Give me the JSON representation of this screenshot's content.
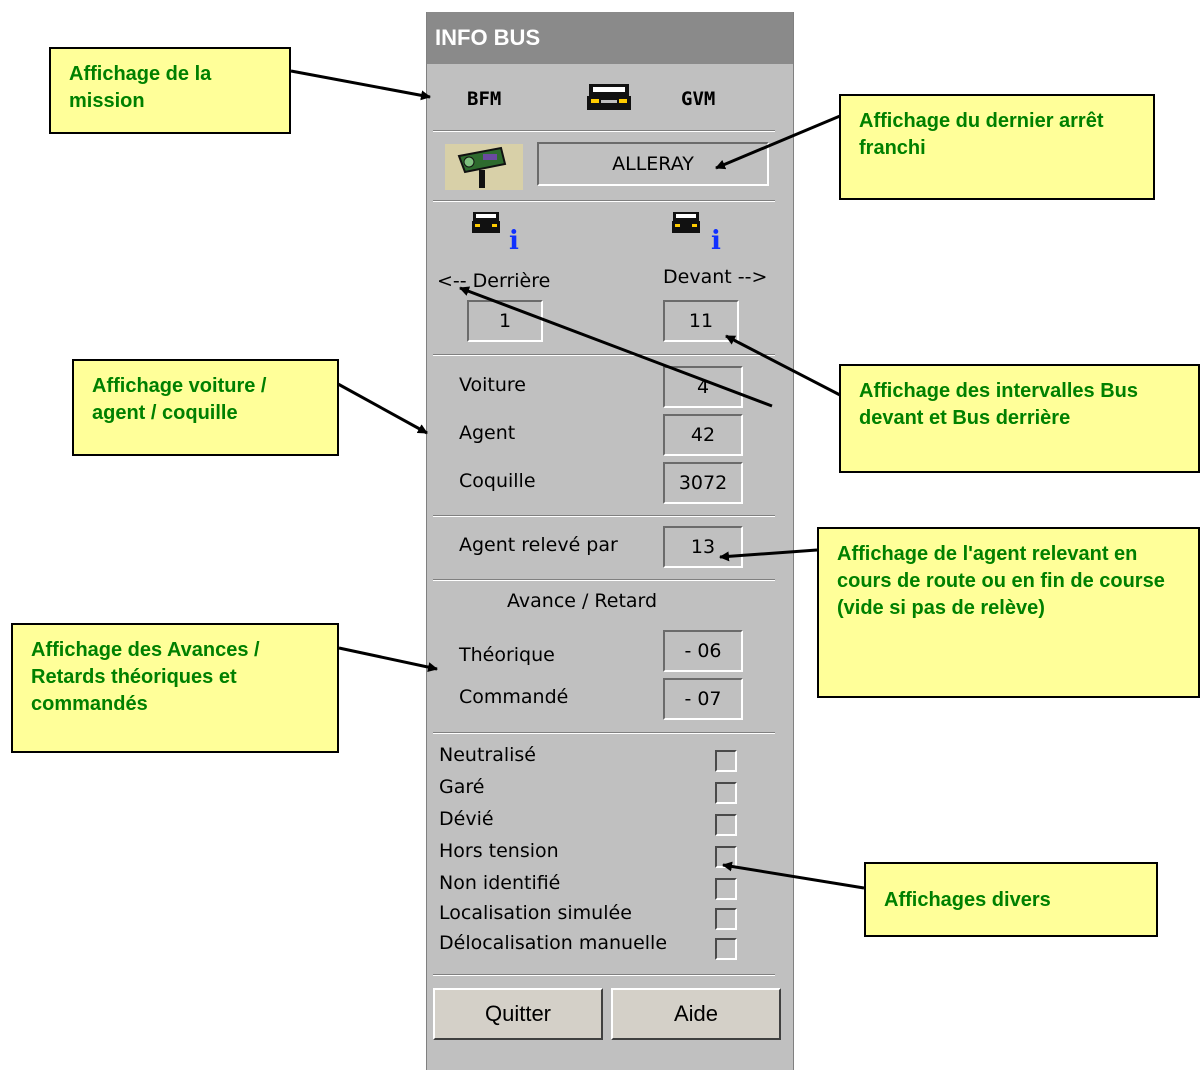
{
  "window": {
    "title": "INFO BUS"
  },
  "mission": {
    "left": "BFM",
    "right": "GVM"
  },
  "stop": {
    "name": "ALLERAY"
  },
  "intervals": {
    "behind_label": "<-- Derrière",
    "front_label": "Devant -->",
    "behind_value": "1",
    "front_value": "11"
  },
  "identity": {
    "voiture_label": "Voiture",
    "voiture_value": "4",
    "agent_label": "Agent",
    "agent_value": "42",
    "coquille_label": "Coquille",
    "coquille_value": "3072"
  },
  "relief": {
    "label": "Agent relevé par",
    "value": "13"
  },
  "delay": {
    "title": "Avance / Retard",
    "theorique_label": "Théorique",
    "theorique_value": "- 06",
    "commande_label": "Commandé",
    "commande_value": "- 07"
  },
  "flags": [
    "Neutralisé",
    "Garé",
    "Dévié",
    "Hors tension",
    "Non identifié",
    "Localisation simulée",
    "Délocalisation manuelle"
  ],
  "buttons": {
    "quit": "Quitter",
    "help": "Aide"
  },
  "callouts": {
    "mission": "Affichage de la mission",
    "stop": "Affichage du dernier arrêt franchi",
    "identity": "Affichage voiture / agent / coquille",
    "intervals": "Affichage des intervalles Bus devant et Bus derrière",
    "relief": "Affichage de l'agent relevant en cours de route ou en fin de course (vide si pas de relève)",
    "delay": "Affichage des Avances / Retards théoriques et commandés",
    "misc": "Affichages divers"
  },
  "colors": {
    "callout_bg": "#ffff99",
    "callout_text": "#008000",
    "panel": "#c0c0c0"
  },
  "icons": [
    "bus-icon",
    "bus-stop-sign-icon",
    "info-icon"
  ]
}
